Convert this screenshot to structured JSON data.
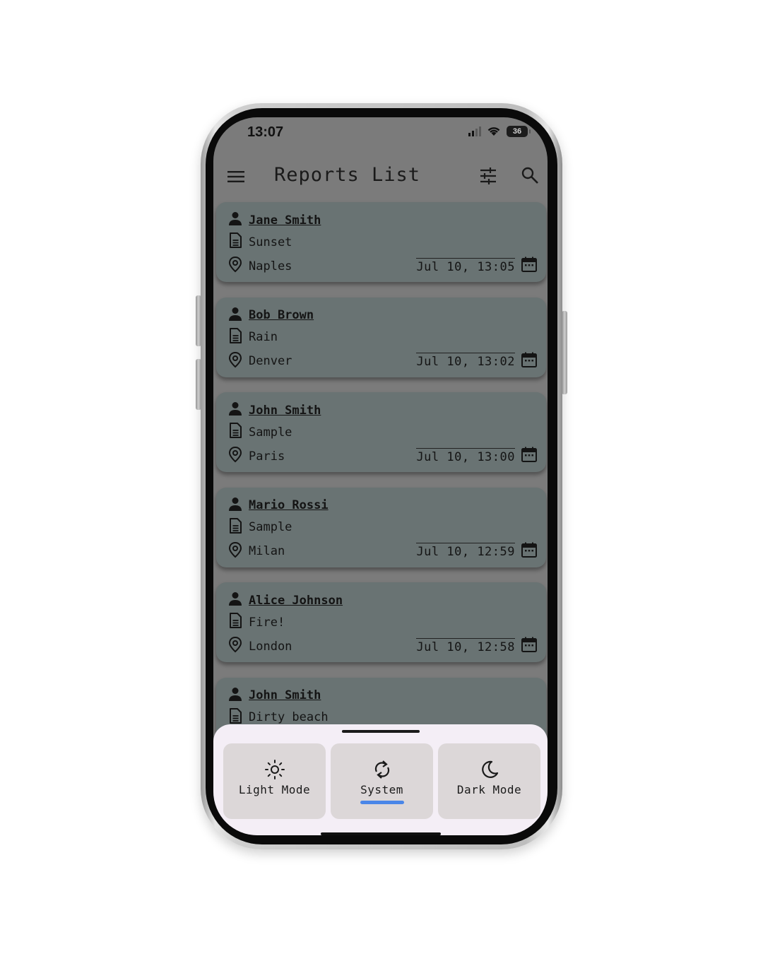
{
  "status_bar": {
    "time": "13:07",
    "battery": "36"
  },
  "app_bar": {
    "title": "Reports List",
    "menu_icon": "menu-icon",
    "filter_icon": "tune-icon",
    "search_icon": "search-icon"
  },
  "reports": [
    {
      "name": "Jane Smith",
      "title": "Sunset",
      "location": "Naples",
      "date": "Jul 10, 13:05"
    },
    {
      "name": "Bob Brown",
      "title": "Rain",
      "location": "Denver",
      "date": "Jul 10, 13:02"
    },
    {
      "name": "John Smith",
      "title": "Sample",
      "location": "Paris",
      "date": "Jul 10, 13:00"
    },
    {
      "name": "Mario Rossi",
      "title": "Sample",
      "location": "Milan",
      "date": "Jul 10, 12:59"
    },
    {
      "name": "Alice Johnson",
      "title": "Fire!",
      "location": "London",
      "date": "Jul 10, 12:58"
    },
    {
      "name": "John Smith",
      "title": "Dirty beach",
      "location": "",
      "date": ""
    }
  ],
  "theme_sheet": {
    "options": [
      {
        "label": "Light Mode",
        "icon": "sun-icon",
        "selected": false
      },
      {
        "label": "System",
        "icon": "sync-icon",
        "selected": true
      },
      {
        "label": "Dark Mode",
        "icon": "moon-icon",
        "selected": false
      }
    ],
    "accent": "#4a86e8"
  },
  "colors": {
    "card": "#697373",
    "scrim": "#7b7b7b",
    "sheet": "#f4eef6"
  }
}
